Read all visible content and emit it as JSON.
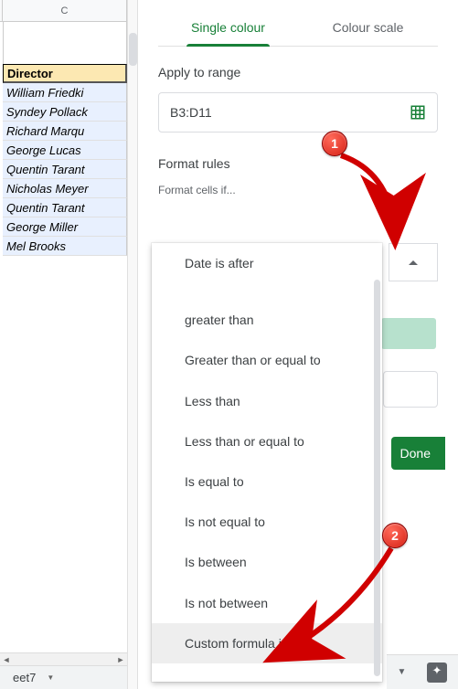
{
  "sheet": {
    "column_label": "C",
    "header": "Director",
    "rows": [
      "William Friedki",
      "Syndey Pollack",
      "Richard Marqu",
      "George Lucas",
      "Quentin Tarant",
      "Nicholas Meyer",
      "Quentin Tarant",
      "George Miller",
      "Mel Brooks"
    ],
    "tab_name": "eet7"
  },
  "panel": {
    "tabs": {
      "single": "Single colour",
      "scale": "Colour scale"
    },
    "apply_label": "Apply to range",
    "range_value": "B3:D11",
    "format_rules_label": "Format rules",
    "format_if_label": "Format cells if...",
    "done": "Done"
  },
  "dropdown": {
    "options": [
      "Date is after",
      "greater than",
      "Greater than or equal to",
      "Less than",
      "Less than or equal to",
      "Is equal to",
      "Is not equal to",
      "Is between",
      "Is not between",
      "Custom formula is"
    ]
  },
  "annotations": {
    "one": "1",
    "two": "2"
  }
}
